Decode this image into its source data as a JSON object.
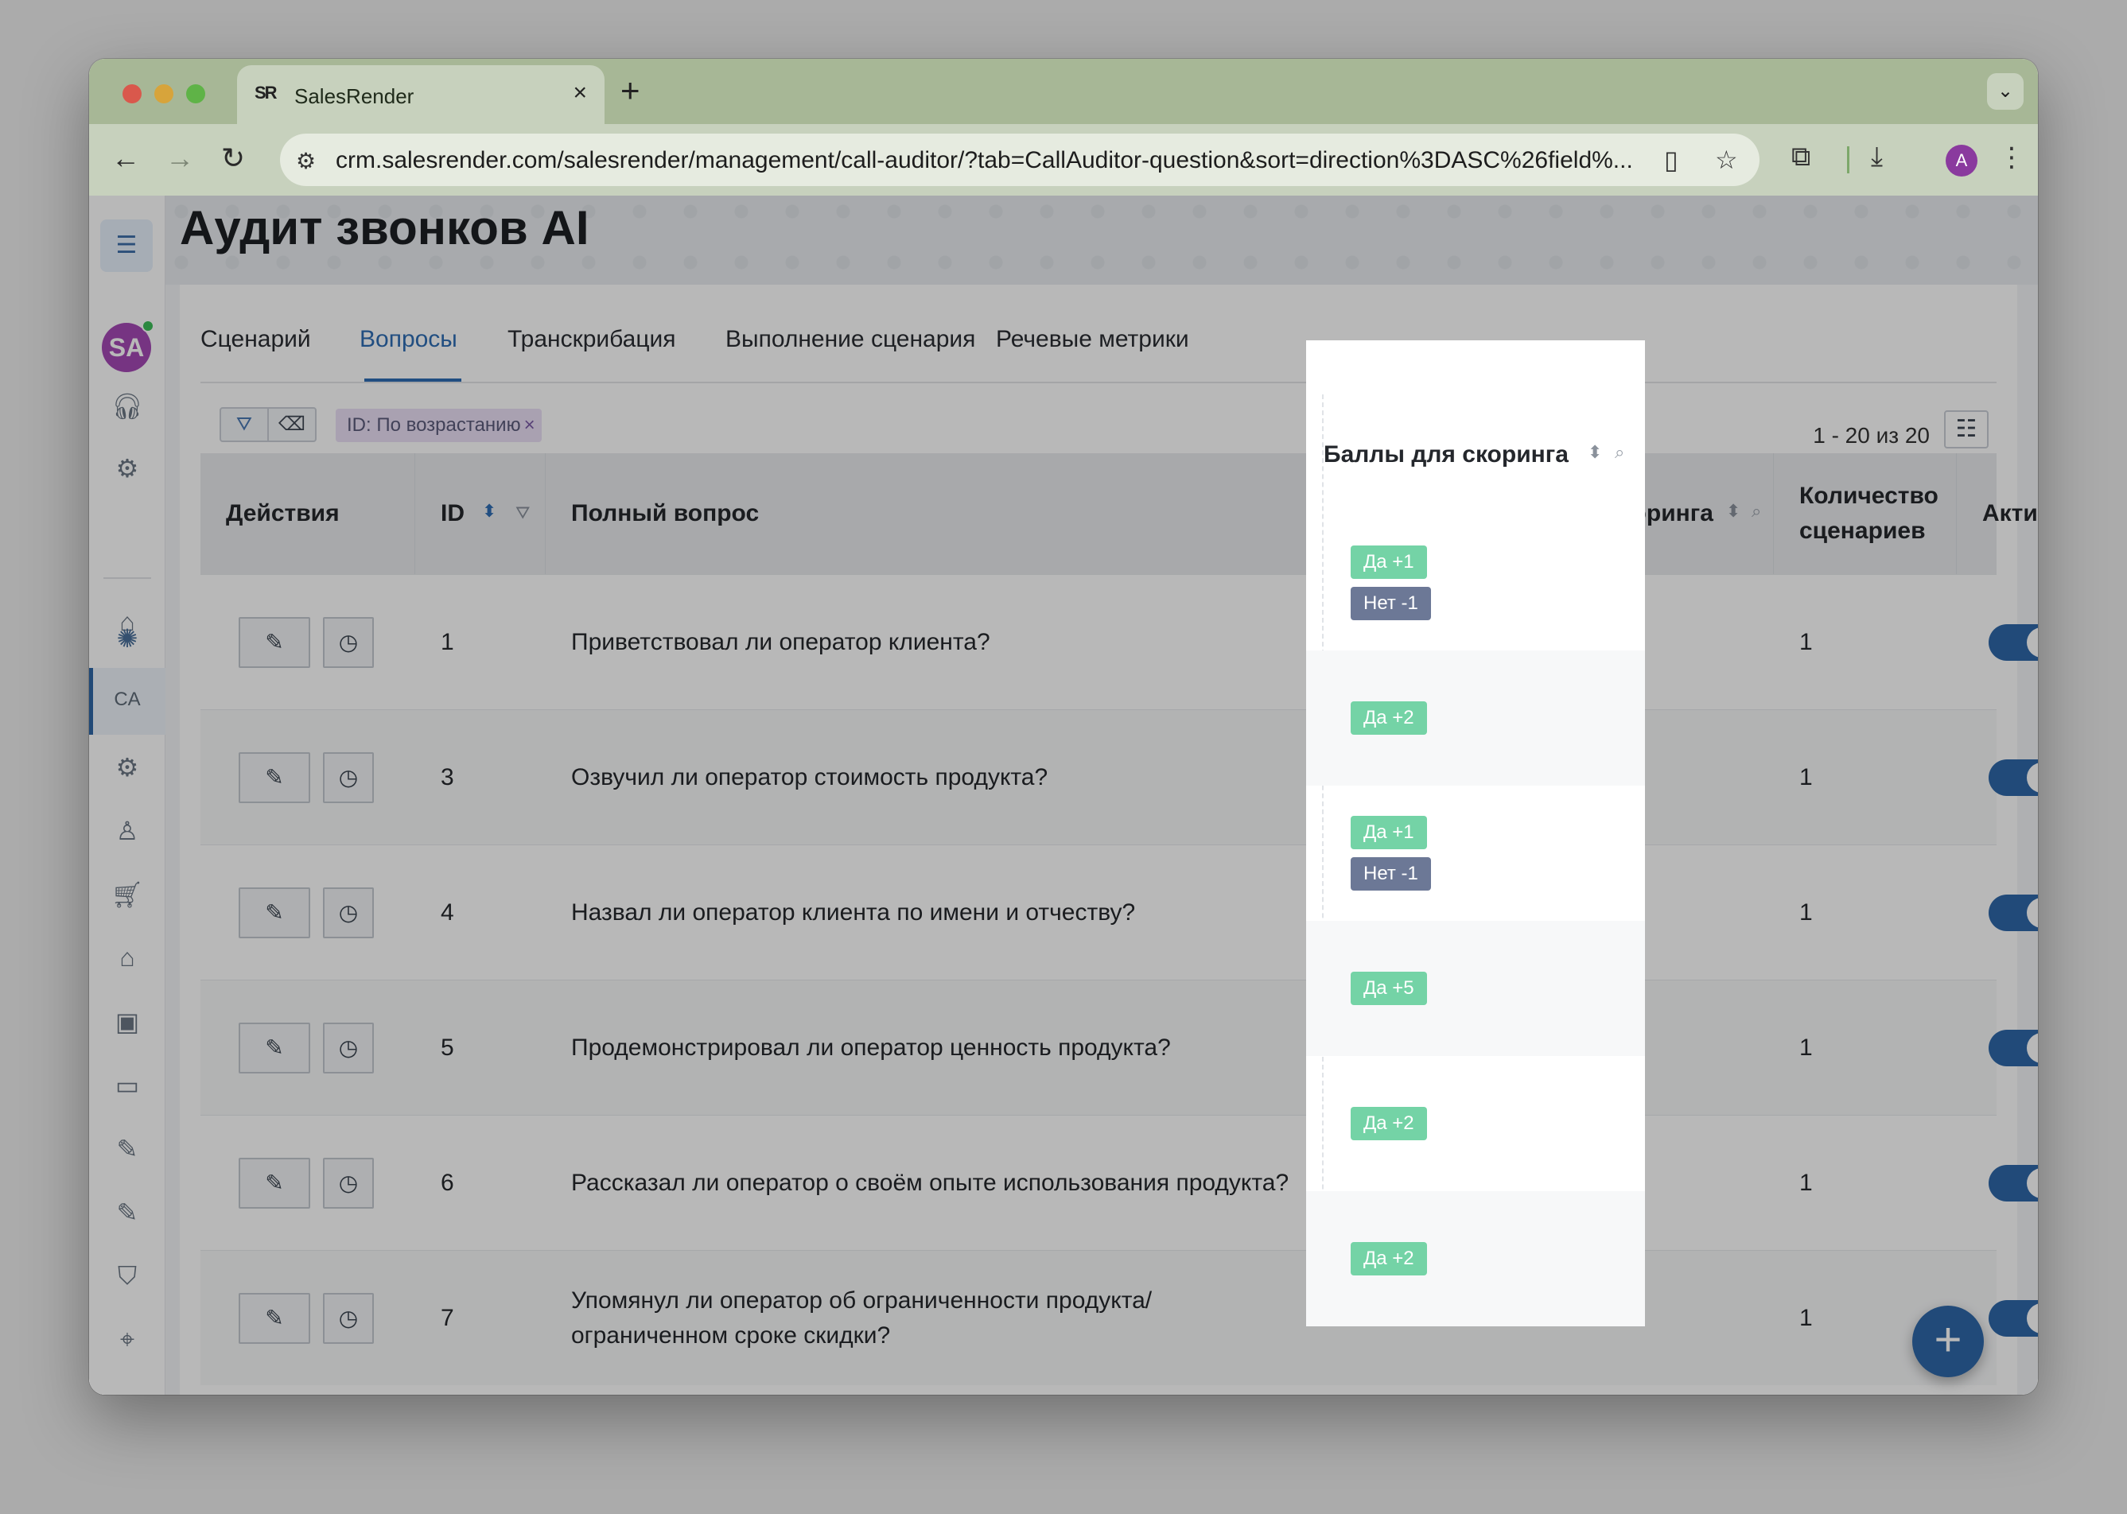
{
  "browser": {
    "tab_title": "SalesRender",
    "favicon_text": "SR",
    "url": "crm.salesrender.com/salesrender/management/call-auditor/?tab=CallAuditor-question&sort=direction%3DASC%26field%...",
    "profile_initial": "A"
  },
  "sidebar": {
    "avatar_initials": "SA",
    "active_label": "CA"
  },
  "page": {
    "title": "Аудит звонков AI",
    "tabs": [
      {
        "label": "Сценарий"
      },
      {
        "label": "Вопросы"
      },
      {
        "label": "Транскрибация"
      },
      {
        "label": "Выполнение сценария"
      },
      {
        "label": "Речевые метрики"
      }
    ],
    "active_tab": "Вопросы",
    "filter_chip": "ID: По возрастанию",
    "pagination": "1 - 20 из 20"
  },
  "table": {
    "headers": {
      "actions": "Действия",
      "id": "ID",
      "question": "Полный вопрос",
      "scores": "Баллы для скоринга",
      "scenarios_line1": "Количество",
      "scenarios_line2": "сценариев",
      "active": "Активно"
    },
    "rows": [
      {
        "id": "1",
        "question": "Приветствовал ли оператор клиента?",
        "question2": "",
        "yes": "Да  +1",
        "no": "Нет  -1",
        "scenarios": "1",
        "active": true
      },
      {
        "id": "3",
        "question": "Озвучил ли оператор стоимость продукта?",
        "question2": "",
        "yes": "Да  +2",
        "no": "",
        "scenarios": "1",
        "active": true
      },
      {
        "id": "4",
        "question": "Назвал ли оператор клиента по имени и отчеству?",
        "question2": "",
        "yes": "Да  +1",
        "no": "Нет  -1",
        "scenarios": "1",
        "active": true
      },
      {
        "id": "5",
        "question": "Продемонстрировал ли оператор ценность продукта?",
        "question2": "",
        "yes": "Да  +5",
        "no": "",
        "scenarios": "1",
        "active": true
      },
      {
        "id": "6",
        "question": "Рассказал ли оператор о своём опыте использования продукта?",
        "question2": "",
        "yes": "Да  +2",
        "no": "",
        "scenarios": "1",
        "active": true
      },
      {
        "id": "7",
        "question": "Упомянул ли оператор об ограниченности продукта/",
        "question2": "ограниченном сроке скидки?",
        "yes": "Да  +2",
        "no": "",
        "scenarios": "1",
        "active": true
      }
    ]
  },
  "colors": {
    "accent": "#2e67a8",
    "yes_badge": "#74d3a6",
    "no_badge": "#6c7896",
    "chip_bg": "#eadff6"
  }
}
